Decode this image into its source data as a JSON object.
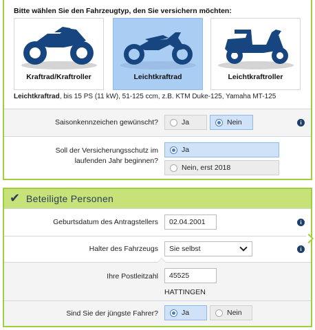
{
  "vehicle_section": {
    "title": "Bitte wählen Sie den Fahrzeugtyp, den Sie versichern möchten:",
    "options": [
      {
        "label": "Kraftrad/Kraftroller",
        "icon": "sport-motorcycle-icon",
        "selected": false
      },
      {
        "label": "Leichtkraftrad",
        "icon": "dirt-bike-icon",
        "selected": true
      },
      {
        "label": "Leichtkraftroller",
        "icon": "scooter-icon",
        "selected": false
      }
    ],
    "description_bold": "Leichtkraftrad",
    "description_rest": ", bis 15 PS (11 kW), 51-125 ccm, z.B. KTM Duke-125, Yamaha MT-125"
  },
  "saison": {
    "label": "Saisonkennzeichen gewünscht?",
    "opt_ja": "Ja",
    "opt_nein": "Nein",
    "selected": "Nein"
  },
  "versicherungsschutz": {
    "label": "Soll der Versicherungsschutz im laufenden Jahr beginnen?",
    "opt_ja": "Ja",
    "opt_nein": "Nein, erst 2018",
    "selected": "Ja"
  },
  "beteiligte": {
    "title": "Beteiligte Personen",
    "geburtsdatum_label": "Geburtsdatum des Antragstellers",
    "geburtsdatum_value": "02.04.2001",
    "halter_label": "Halter des Fahrzeugs",
    "halter_value": "Sie selbst",
    "plz_label": "Ihre Postleitzahl",
    "plz_value": "45525",
    "ort": "HATTINGEN",
    "juengster_label": "Sind Sie der jüngste Fahrer?",
    "opt_ja": "Ja",
    "opt_nein": "Nein",
    "selected": "Ja"
  },
  "colors": {
    "accent_green": "#9fcf3a",
    "header_green": "#c8e27a",
    "selected_blue": "#a9cdf3",
    "icon_navy": "#17457f"
  }
}
